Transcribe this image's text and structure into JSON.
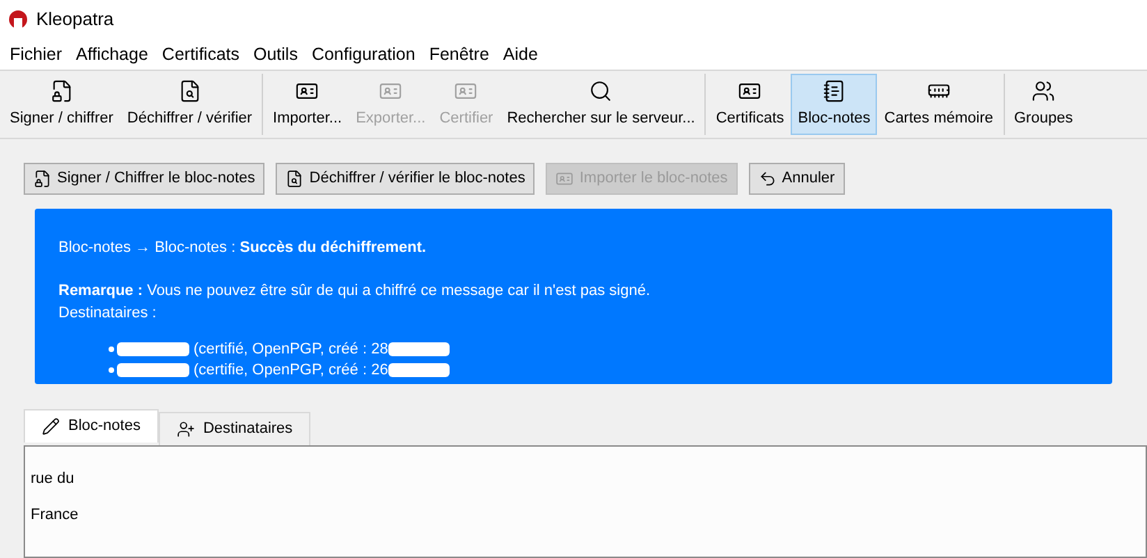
{
  "window": {
    "title": "Kleopatra"
  },
  "menu": [
    "Fichier",
    "Affichage",
    "Certificats",
    "Outils",
    "Configuration",
    "Fenêtre",
    "Aide"
  ],
  "toolbar_groups": [
    {
      "items": [
        {
          "label": "Signer / chiffrer",
          "disabled": false,
          "selected": false
        },
        {
          "label": "Déchiffrer / vérifier",
          "disabled": false,
          "selected": false
        }
      ]
    },
    {
      "items": [
        {
          "label": "Importer...",
          "disabled": false,
          "selected": false
        },
        {
          "label": "Exporter...",
          "disabled": true,
          "selected": false
        },
        {
          "label": "Certifier",
          "disabled": true,
          "selected": false
        },
        {
          "label": "Rechercher sur le serveur...",
          "disabled": false,
          "selected": false
        }
      ]
    },
    {
      "items": [
        {
          "label": "Certificats",
          "disabled": false,
          "selected": false
        },
        {
          "label": "Bloc-notes",
          "disabled": false,
          "selected": true
        },
        {
          "label": "Cartes mémoire",
          "disabled": false,
          "selected": false
        }
      ]
    },
    {
      "items": [
        {
          "label": "Groupes",
          "disabled": false,
          "selected": false
        }
      ]
    }
  ],
  "action_buttons": [
    {
      "label": "Signer / Chiffrer le bloc-notes",
      "disabled": false
    },
    {
      "label": "Déchiffrer / vérifier le bloc-notes",
      "disabled": false
    },
    {
      "label": "Importer le bloc-notes",
      "disabled": true
    },
    {
      "label": "Annuler",
      "disabled": false
    }
  ],
  "message": {
    "heading": "Bloc-notes → Bloc-notes : **Succès du déchiffrement.**",
    "remark": "**Remarque :** Vous ne pouvez être sûr de qui a chiffré ce message car il n'est pas signé.",
    "recipients_label": "Destinataires :",
    "recipients": [
      "(certifié, OpenPGP, créé : 28",
      "(certifie, OpenPGP, créé : 26"
    ]
  },
  "tabs": [
    {
      "label": "Bloc-notes",
      "selected": true
    },
    {
      "label": "Destinataires",
      "selected": false
    }
  ],
  "notepad_lines": [
    {
      "kind": "redacted"
    },
    {
      "kind": "text",
      "text": "rue du"
    },
    {
      "kind": "redacted"
    },
    {
      "kind": "text",
      "text": "France"
    }
  ]
}
